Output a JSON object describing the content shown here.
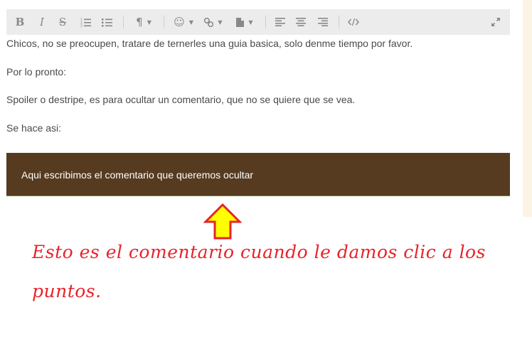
{
  "colors": {
    "toolbar_bg": "#ececec",
    "icon": "#888888",
    "body_text": "#4a4a4a",
    "spoiler_bg": "#563b20",
    "spoiler_text": "#ffffff",
    "annotation": "#e8232a",
    "arrow_fill": "#ffff00",
    "arrow_stroke": "#e8232a"
  },
  "toolbar": {
    "bold": "B",
    "italic": "I",
    "strike": "S",
    "paragraph": "¶",
    "smiley": "☺",
    "caret": "▼"
  },
  "editor": {
    "paragraphs": [
      "Chicos, no se preocupen, tratare de ternerles una guia basica, solo denme tiempo por favor.",
      "Por lo pronto:",
      "Spoiler o destripe, es para ocultar un comentario, que no se quiere que se vea.",
      "Se hace asi:"
    ],
    "spoiler_text": "Aqui escribimos el comentario que queremos ocultar"
  },
  "annotation": {
    "line1": "Esto es el comentario cuando le damos clic a los",
    "line2": "puntos."
  }
}
